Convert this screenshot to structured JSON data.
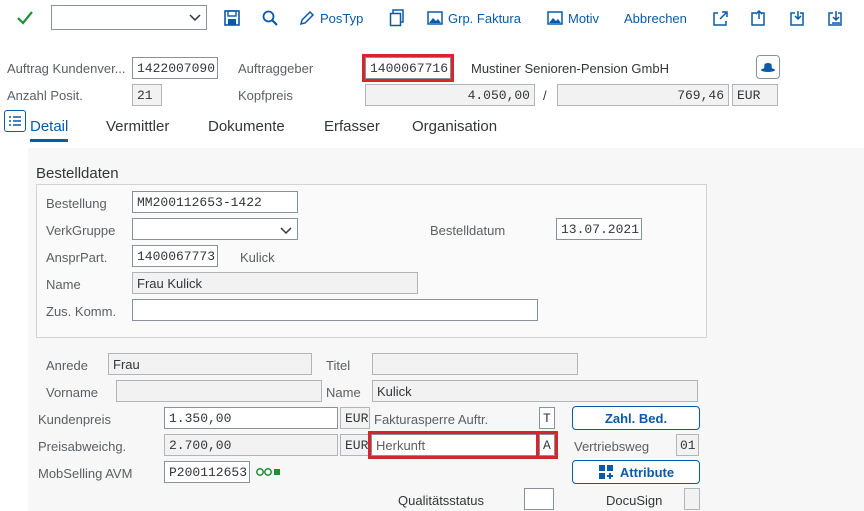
{
  "toolbar": {
    "command_value": "",
    "postyp": "PosTyp",
    "grp_faktura": "Grp. Faktura",
    "motiv": "Motiv",
    "abbrechen": "Abbrechen"
  },
  "header": {
    "auftrag_label": "Auftrag Kundenver...",
    "auftrag_value": "1422007090",
    "auftraggeber_label": "Auftraggeber",
    "auftraggeber_value": "1400067716",
    "auftraggeber_name": "Mustiner Senioren-Pension GmbH",
    "anzahl_label": "Anzahl Posit.",
    "anzahl_value": "21",
    "kopfpreis_label": "Kopfpreis",
    "kopfpreis_value": "4.050,00",
    "separator": "/",
    "kopfpreis_value2": "769,46",
    "currency": "EUR"
  },
  "tabs": [
    {
      "label": "Detail",
      "active": true
    },
    {
      "label": "Vermittler",
      "active": false
    },
    {
      "label": "Dokumente",
      "active": false
    },
    {
      "label": "Erfasser",
      "active": false
    },
    {
      "label": "Organisation",
      "active": false
    }
  ],
  "bestelldaten": {
    "title": "Bestelldaten",
    "bestellung_label": "Bestellung",
    "bestellung_value": "MM200112653-1422",
    "verkgruppe_label": "VerkGruppe",
    "verkgruppe_value": "",
    "bestelldatum_label": "Bestelldatum",
    "bestelldatum_value": "13.07.2021",
    "anspr_label": "AnsprPart.",
    "anspr_value": "1400067773",
    "anspr_name": "Kulick",
    "name_label": "Name",
    "name_value": "Frau Kulick",
    "zuskomm_label": "Zus. Komm.",
    "zuskomm_value": ""
  },
  "person": {
    "anrede_label": "Anrede",
    "anrede_value": "Frau",
    "titel_label": "Titel",
    "titel_value": "",
    "vorname_label": "Vorname",
    "vorname_value": "",
    "name_label": "Name",
    "name_value": "Kulick"
  },
  "pricing": {
    "kundenpreis_label": "Kundenpreis",
    "kundenpreis_value": "1.350,00",
    "kundenpreis_cur": "EUR",
    "fakturasperre_label": "Fakturasperre Auftr.",
    "fakturasperre_value": "T",
    "zahl_bed_button": "Zahl. Bed.",
    "preisabw_label": "Preisabweichg.",
    "preisabw_value": "2.700,00",
    "preisabw_cur": "EUR",
    "herkunft_label": "Herkunft",
    "herkunft_value": "A",
    "vertriebsweg_label": "Vertriebsweg",
    "vertriebsweg_value": "01",
    "mobselling_label": "MobSelling AVM",
    "mobselling_value": "P200112653",
    "attribute_button": "Attribute",
    "qualitaet_label": "Qualitätsstatus",
    "qualitaet_value": "",
    "docusign_label": "DocuSign",
    "docusign_value": ""
  },
  "colors": {
    "accent": "#0a5aa8",
    "highlight": "#d8242b",
    "check": "#1f8f3a"
  }
}
